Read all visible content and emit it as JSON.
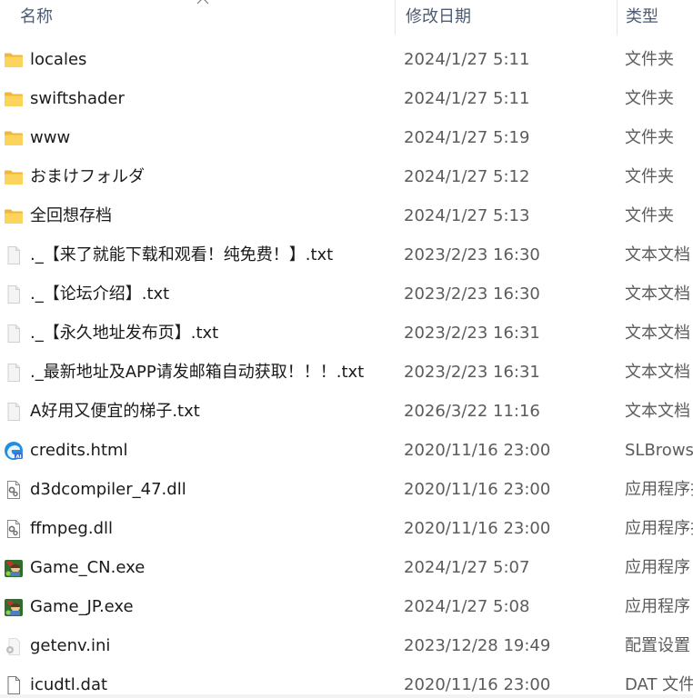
{
  "columns": {
    "name": "名称",
    "date": "修改日期",
    "type": "类型"
  },
  "files": [
    {
      "name": "locales",
      "date": "2024/1/27 5:11",
      "type": "文件夹",
      "icon": "folder-icon"
    },
    {
      "name": "swiftshader",
      "date": "2024/1/27 5:11",
      "type": "文件夹",
      "icon": "folder-icon"
    },
    {
      "name": "www",
      "date": "2024/1/27 5:19",
      "type": "文件夹",
      "icon": "folder-icon"
    },
    {
      "name": "おまけフォルダ",
      "date": "2024/1/27 5:12",
      "type": "文件夹",
      "icon": "folder-icon"
    },
    {
      "name": "全回想存档",
      "date": "2024/1/27 5:13",
      "type": "文件夹",
      "icon": "folder-icon"
    },
    {
      "name": "._【来了就能下载和观看！纯免费！】.txt",
      "date": "2023/2/23 16:30",
      "type": "文本文档",
      "icon": "text-file-icon"
    },
    {
      "name": "._【论坛介绍】.txt",
      "date": "2023/2/23 16:30",
      "type": "文本文档",
      "icon": "text-file-icon"
    },
    {
      "name": "._【永久地址发布页】.txt",
      "date": "2023/2/23 16:31",
      "type": "文本文档",
      "icon": "text-file-icon"
    },
    {
      "name": "._最新地址及APP请发邮箱自动获取！！！.txt",
      "date": "2023/2/23 16:31",
      "type": "文本文档",
      "icon": "text-file-icon"
    },
    {
      "name": "A好用又便宜的梯子.txt",
      "date": "2026/3/22 11:16",
      "type": "文本文档",
      "icon": "text-file-icon"
    },
    {
      "name": "credits.html",
      "date": "2020/11/16 23:00",
      "type": "SLBrowse",
      "icon": "browser-html-icon"
    },
    {
      "name": "d3dcompiler_47.dll",
      "date": "2020/11/16 23:00",
      "type": "应用程序扩",
      "icon": "dll-file-icon"
    },
    {
      "name": "ffmpeg.dll",
      "date": "2020/11/16 23:00",
      "type": "应用程序扩",
      "icon": "dll-file-icon"
    },
    {
      "name": "Game_CN.exe",
      "date": "2024/1/27 5:07",
      "type": "应用程序",
      "icon": "game-exe-icon"
    },
    {
      "name": "Game_JP.exe",
      "date": "2024/1/27 5:08",
      "type": "应用程序",
      "icon": "game-exe-icon"
    },
    {
      "name": "getenv.ini",
      "date": "2023/12/28 19:49",
      "type": "配置设置",
      "icon": "config-file-icon"
    },
    {
      "name": "icudtl.dat",
      "date": "2020/11/16 23:00",
      "type": "DAT 文件",
      "icon": "blank-file-icon"
    }
  ],
  "colors": {
    "folder": "#f8c74a",
    "header_text": "#4d5b73",
    "name_text": "#1a1a1a",
    "meta_text": "#5c5c5c"
  }
}
